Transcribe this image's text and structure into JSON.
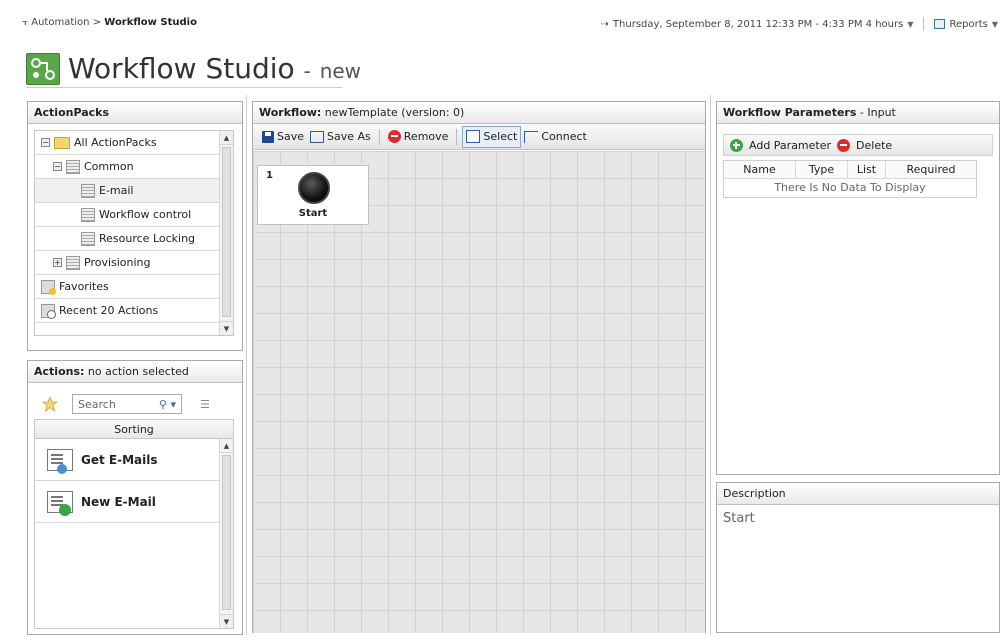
{
  "breadcrumb": {
    "parent": "Automation",
    "separator": ">",
    "current": "Workflow Studio"
  },
  "timerange": {
    "text": "Thursday, September 8, 2011 12:33 PM - 4:33 PM 4 hours"
  },
  "reports": {
    "label": "Reports"
  },
  "page": {
    "title": "Workflow Studio",
    "dash": "-",
    "subtitle": "new"
  },
  "actionpacks": {
    "header": "ActionPacks",
    "items": [
      {
        "label": "All ActionPacks"
      },
      {
        "label": "Common"
      },
      {
        "label": "E-mail"
      },
      {
        "label": "Workflow control"
      },
      {
        "label": "Resource Locking"
      },
      {
        "label": "Provisioning"
      },
      {
        "label": "Favorites"
      },
      {
        "label": "Recent 20 Actions"
      }
    ]
  },
  "actions": {
    "header_bold": "Actions:",
    "header_rest": " no action selected",
    "search_placeholder": "Search",
    "sorting": "Sorting",
    "items": [
      {
        "label": "Get E-Mails"
      },
      {
        "label": "New E-Mail"
      }
    ]
  },
  "workflow": {
    "header_bold": "Workflow:",
    "header_rest": " newTemplate (version: 0)",
    "toolbar": {
      "save": "Save",
      "save_as": "Save As",
      "remove": "Remove",
      "select": "Select",
      "connect": "Connect"
    },
    "node": {
      "number": "1",
      "label": "Start"
    }
  },
  "params": {
    "header_bold": "Workflow Parameters",
    "header_rest": " - Input",
    "add": "Add Parameter",
    "delete": "Delete",
    "columns": [
      "Name",
      "Type",
      "List",
      "Required"
    ],
    "empty": "There Is No Data To Display"
  },
  "description": {
    "header": "Description",
    "text": "Start"
  },
  "colors": {
    "accent": "#5aa64a",
    "canvas": "#e7e7e7",
    "remove": "#d92d2d",
    "add": "#39a544"
  }
}
